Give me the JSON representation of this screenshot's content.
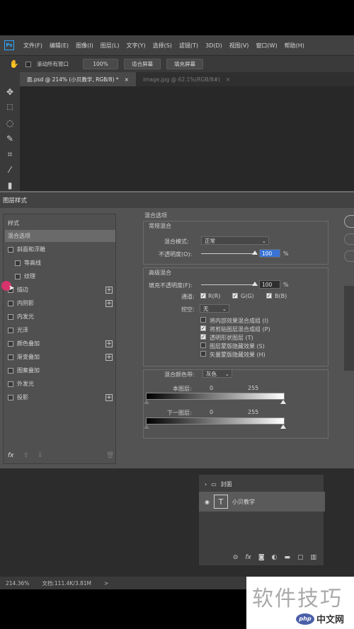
{
  "app": {
    "logo": "Ps"
  },
  "menu": [
    "文件(F)",
    "编辑(E)",
    "图像(I)",
    "图层(L)",
    "文字(Y)",
    "选择(S)",
    "滤镜(T)",
    "3D(D)",
    "视图(V)",
    "窗口(W)",
    "帮助(H)"
  ],
  "options": {
    "scroll_all": "滚动所有窗口",
    "zoom": "100%",
    "fit_screen": "适合屏幕",
    "fill_screen": "填充屏幕"
  },
  "tabs": [
    {
      "label": "面.psd @ 214% (小贝教学, RGB/8) *",
      "close": "×"
    },
    {
      "label": "image.jpg @ 62.1%(RGB/8#)",
      "close": "×"
    }
  ],
  "dialog": {
    "title": "图层样式",
    "left_items": [
      {
        "label": "样式"
      },
      {
        "label": "混合选项"
      },
      {
        "label": "斜面和浮雕"
      },
      {
        "label": "等高线"
      },
      {
        "label": "纹理"
      },
      {
        "label": "描边"
      },
      {
        "label": "内阴影"
      },
      {
        "label": "内发光"
      },
      {
        "label": "光泽"
      },
      {
        "label": "颜色叠加"
      },
      {
        "label": "渐变叠加"
      },
      {
        "label": "图案叠加"
      },
      {
        "label": "外发光"
      },
      {
        "label": "投影"
      }
    ],
    "fx": "fx",
    "blend": {
      "section_title": "混合选项",
      "general_title": "常规混合",
      "mode_label": "混合模式:",
      "mode_value": "正常",
      "opacity_label": "不透明度(O):",
      "opacity_value": "100",
      "opacity_pct": "%",
      "opacity_level": 1.0,
      "advanced_title": "高级混合",
      "fill_label": "填充不透明度(F):",
      "fill_value": "100",
      "fill_pct": "%",
      "fill_level": 1.0,
      "channels_label": "通道:",
      "r": "R(R)",
      "g": "G(G)",
      "b": "B(B)",
      "knockout_label": "挖空:",
      "knockout_value": "无",
      "opts": [
        "将内部效果混合成组 (I)",
        "将剪贴图层混合成组 (P)",
        "透明形状图层 (T)",
        "图层蒙版隐藏效果 (S)",
        "矢量蒙版隐藏效果 (H)"
      ],
      "blendif_label": "混合颜色带:",
      "blendif_value": "灰色",
      "this_layer": "本图层:",
      "this_min": "0",
      "this_max": "255",
      "under_layer": "下一图层:",
      "under_min": "0",
      "under_max": "255"
    }
  },
  "layers": [
    {
      "name": "封面"
    },
    {
      "name": "小贝教学"
    }
  ],
  "status": {
    "zoom": "214.36%",
    "doc": "文档:111.4K/3.81M",
    "arrow": ">"
  },
  "watermark": {
    "big": "软件技巧",
    "small": "中文网",
    "badge": "php"
  }
}
